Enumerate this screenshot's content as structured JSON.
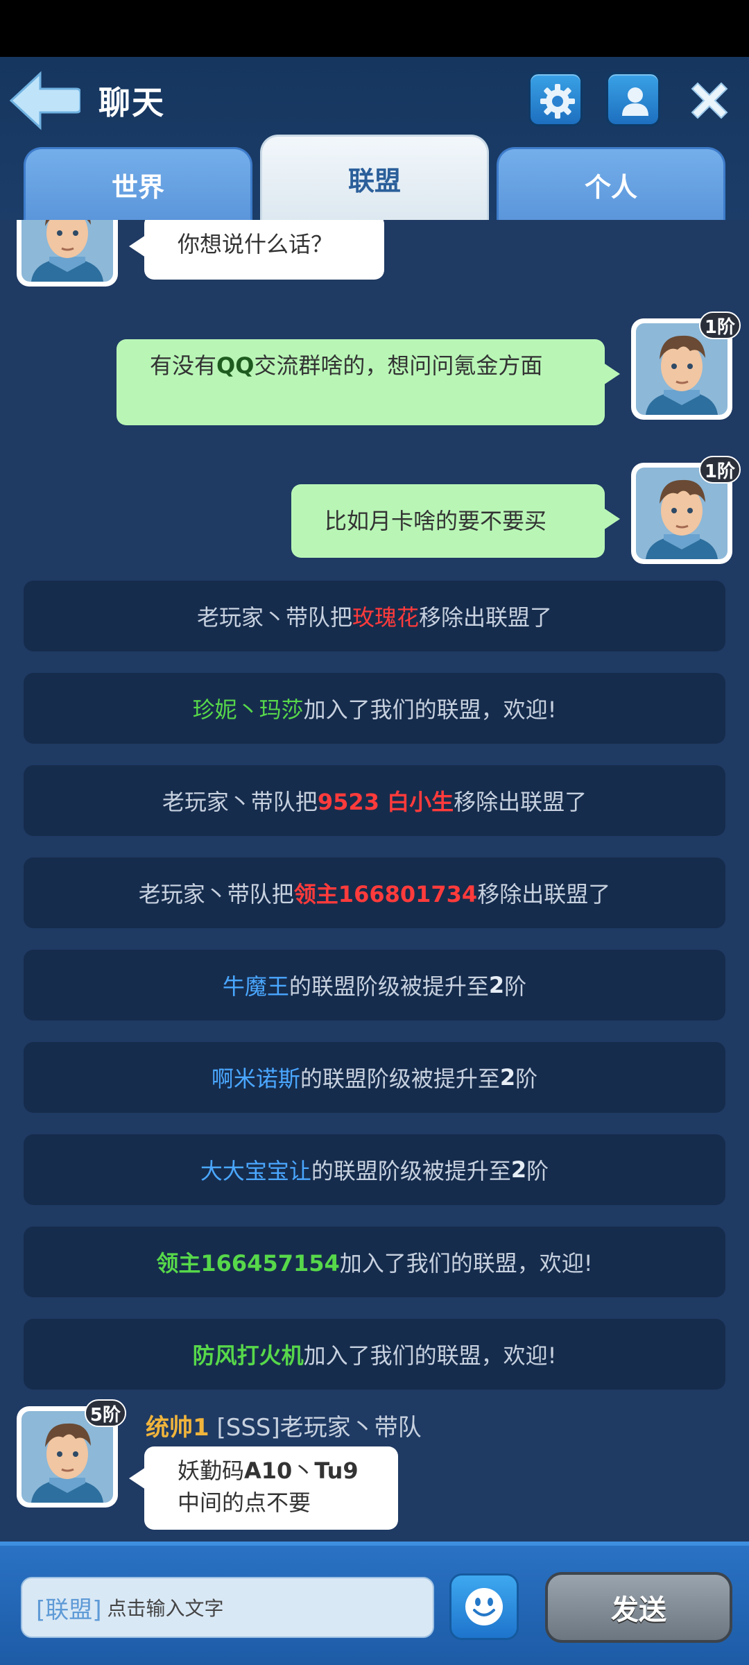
{
  "header": {
    "title": "聊天",
    "tabs": [
      {
        "label": "世界",
        "active": false
      },
      {
        "label": "联盟",
        "active": true
      },
      {
        "label": "个人",
        "active": false
      }
    ]
  },
  "messages": {
    "m1": {
      "text": "你想说什么话？"
    },
    "m2": {
      "rank": "1阶",
      "pre": "有没有",
      "bold": "QQ",
      "post": "交流群啥的，想问问氪金方面"
    },
    "m3": {
      "rank": "1阶",
      "text": "比如月卡啥的要不要买"
    },
    "m4": {
      "rank": "5阶",
      "level": "统帅1",
      "name": "[SSS]老玩家丶带队",
      "line1_pre": "妖勤码",
      "line1_bold1": "A10",
      "line1_sep": "丶",
      "line1_bold2": "Tu9",
      "line2": "中间的点不要"
    }
  },
  "system_messages": {
    "s1": {
      "a": "老玩家丶带队把",
      "b": "玫瑰花",
      "c": "移除出联盟了"
    },
    "s2": {
      "a": "珍妮丶玛莎",
      "b": "加入了我们的联盟，欢迎!"
    },
    "s3": {
      "a": "老玩家丶带队把",
      "b": "9523 白小生",
      "c": "移除出联盟了"
    },
    "s4": {
      "a": "老玩家丶带队把",
      "b": "领主166801734",
      "c": "移除出联盟了"
    },
    "s5": {
      "a": "牛魔王",
      "b": "的联盟阶级被提升至",
      "c": "2",
      "d": "阶"
    },
    "s6": {
      "a": "啊米诺斯",
      "b": "的联盟阶级被提升至",
      "c": "2",
      "d": "阶"
    },
    "s7": {
      "a": "大大宝宝让",
      "b": "的联盟阶级被提升至",
      "c": "2",
      "d": "阶"
    },
    "s8": {
      "a": "领主166457154",
      "b": "加入了我们的联盟，欢迎!"
    },
    "s9": {
      "a": "防风打火机",
      "b": "加入了我们的联盟，欢迎!"
    }
  },
  "footer": {
    "channel": "[联盟]",
    "placeholder": "点击输入文字",
    "send_label": "发送"
  }
}
